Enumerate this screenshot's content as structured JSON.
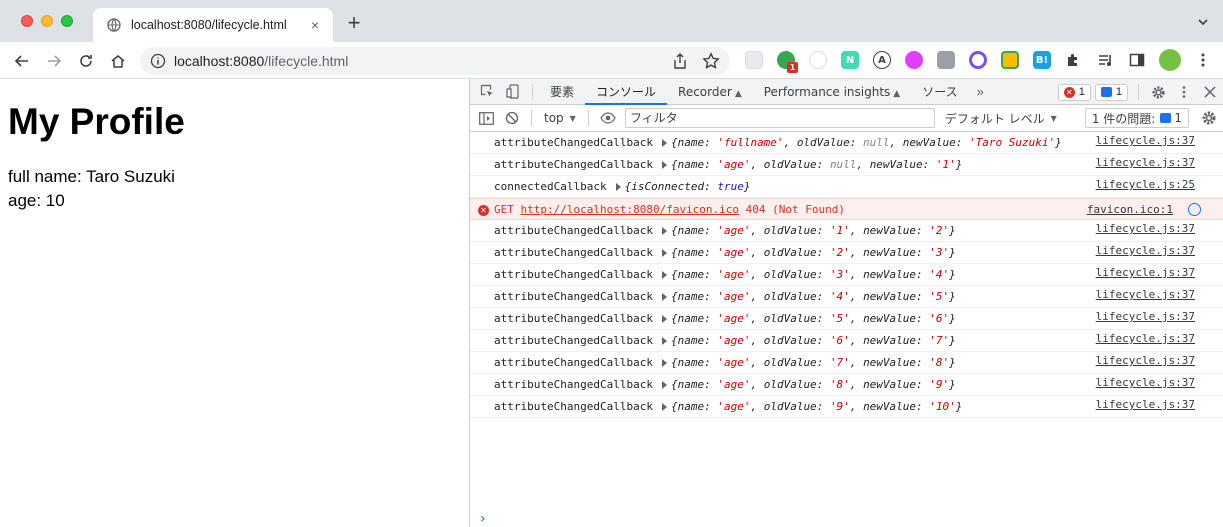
{
  "browser": {
    "tab_title": "localhost:8080/lifecycle.html",
    "close_label": "×",
    "new_tab_label": "+",
    "url_host": "localhost:8080",
    "url_path": "/lifecycle.html"
  },
  "extensions": {
    "badge_count": "1"
  },
  "page": {
    "heading": "My Profile",
    "full_name_line": "full name: Taro Suzuki",
    "age_line": "age: 10"
  },
  "devtools": {
    "tabs": [
      "要素",
      "コンソール",
      "Recorder",
      "Performance insights",
      "ソース"
    ],
    "active_tab": "コンソール",
    "more_tabs": "»",
    "error_count": "1",
    "message_count": "1",
    "context": "top",
    "filter_placeholder": "フィルタ",
    "levels_label": "デフォルト レベル",
    "issues_label": "1 件の問題:",
    "issues_count": "1"
  },
  "console": {
    "rows": [
      {
        "type": "log",
        "prefix": "attributeChangedCallback",
        "name": "'fullname'",
        "old": "null",
        "new": "'Taro Suzuki'",
        "src": "lifecycle.js:37"
      },
      {
        "type": "log",
        "prefix": "attributeChangedCallback",
        "name": "'age'",
        "old": "null",
        "new": "'1'",
        "src": "lifecycle.js:37"
      },
      {
        "type": "connected",
        "prefix": "connectedCallback",
        "key": "isConnected",
        "value": "true",
        "src": "lifecycle.js:25"
      },
      {
        "type": "error",
        "method": "GET",
        "url": "http://localhost:8080/favicon.ico",
        "status": "404 (Not Found)",
        "src": "favicon.ico:1"
      },
      {
        "type": "log",
        "prefix": "attributeChangedCallback",
        "name": "'age'",
        "old": "'1'",
        "new": "'2'",
        "src": "lifecycle.js:37"
      },
      {
        "type": "log",
        "prefix": "attributeChangedCallback",
        "name": "'age'",
        "old": "'2'",
        "new": "'3'",
        "src": "lifecycle.js:37"
      },
      {
        "type": "log",
        "prefix": "attributeChangedCallback",
        "name": "'age'",
        "old": "'3'",
        "new": "'4'",
        "src": "lifecycle.js:37"
      },
      {
        "type": "log",
        "prefix": "attributeChangedCallback",
        "name": "'age'",
        "old": "'4'",
        "new": "'5'",
        "src": "lifecycle.js:37"
      },
      {
        "type": "log",
        "prefix": "attributeChangedCallback",
        "name": "'age'",
        "old": "'5'",
        "new": "'6'",
        "src": "lifecycle.js:37"
      },
      {
        "type": "log",
        "prefix": "attributeChangedCallback",
        "name": "'age'",
        "old": "'6'",
        "new": "'7'",
        "src": "lifecycle.js:37"
      },
      {
        "type": "log",
        "prefix": "attributeChangedCallback",
        "name": "'age'",
        "old": "'7'",
        "new": "'8'",
        "src": "lifecycle.js:37"
      },
      {
        "type": "log",
        "prefix": "attributeChangedCallback",
        "name": "'age'",
        "old": "'8'",
        "new": "'9'",
        "src": "lifecycle.js:37"
      },
      {
        "type": "log",
        "prefix": "attributeChangedCallback",
        "name": "'age'",
        "old": "'9'",
        "new": "'10'",
        "src": "lifecycle.js:37"
      }
    ],
    "prompt": "›"
  }
}
